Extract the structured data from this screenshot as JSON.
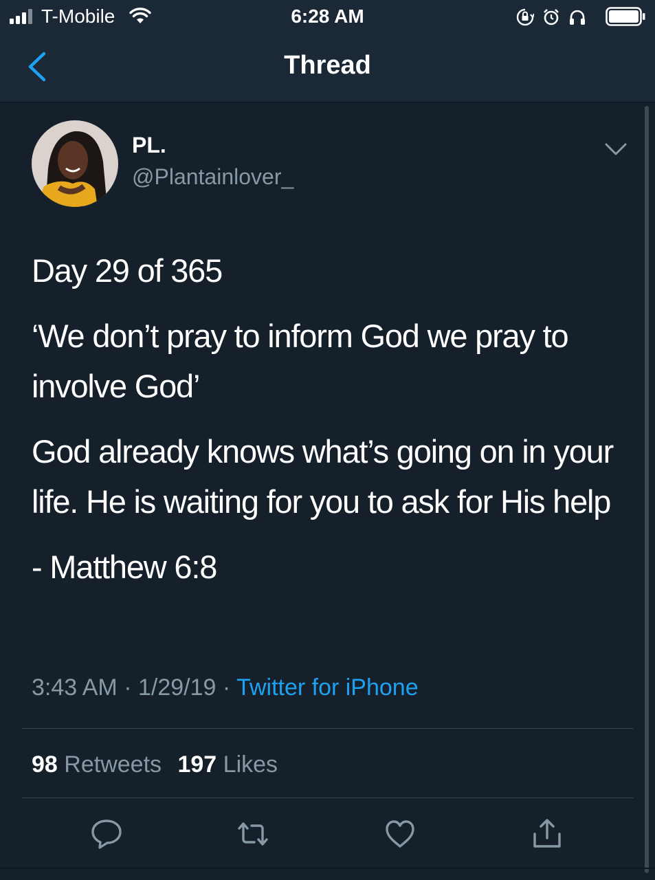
{
  "status_bar": {
    "carrier": "T-Mobile",
    "time": "6:28 AM",
    "signal_bars_filled": 3,
    "signal_bars_total": 4,
    "icons": [
      "signal-icon",
      "wifi-icon",
      "orientation-lock-icon",
      "alarm-icon",
      "headphones-icon",
      "battery-icon"
    ]
  },
  "nav": {
    "title": "Thread",
    "back_icon": "chevron-left-icon"
  },
  "tweet": {
    "display_name": "PL.",
    "handle": "@Plantainlover_",
    "body": [
      "Day 29 of 365",
      "‘We don’t pray to inform God we pray to involve God’",
      "God already knows what’s going on in your life. He is waiting for you to ask for His help",
      "- Matthew 6:8"
    ],
    "time": "3:43 AM",
    "date": "1/29/19",
    "separator": "·",
    "source": "Twitter for iPhone",
    "retweets_count": "98",
    "retweets_label": "Retweets",
    "likes_count": "197",
    "likes_label": "Likes"
  },
  "actions": {
    "icons": [
      "reply-icon",
      "retweet-icon",
      "like-icon",
      "share-icon"
    ]
  },
  "colors": {
    "background": "#15202b",
    "header_background": "#1b2836",
    "accent": "#1da1f2",
    "secondary_text": "#8899a6",
    "divider": "#38444d"
  }
}
